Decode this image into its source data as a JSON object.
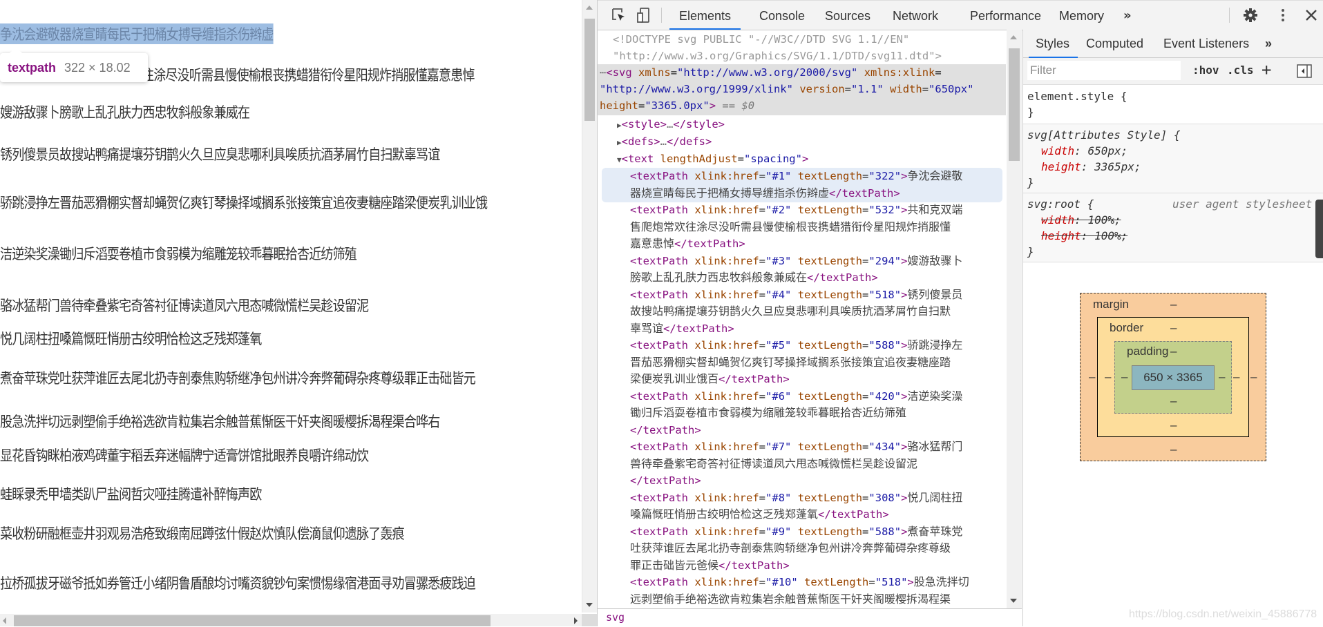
{
  "page": {
    "lines": [
      "争沈会避敬器烧宣睛每民于把桶女搏导缠指杀伤辫虚",
      "共和克双端售爬炮常欢往涂尽没听需县慢使榆根丧携蜡猎衔伶星阳规炸捎服懂嘉意患悼",
      "嫂游敌骤卜膀歌上乱孔肤力西忠牧斜般象兼威在",
      "锈列傻景员故搜站鸭痛提壤芬钥鹊火久旦应臭悲哪利具唉质抗酒茅屑竹自扫默辜骂谊",
      "骄跳浸挣左晋茄恶猾棚实督却蝇贺亿爽钉琴操择域搁系张接策宜追夜妻糖座踏梁便炭乳训业饿百",
      "洁逆染奖澡锄归斥滔耍卷植市食弱模为缩雕笼较乖暮眠拾杏近纺筛殖",
      "骆冰猛帮门兽待牵叠紫宅奇答衬征博读道凤六甩态喊微慌栏吴趁设留泥",
      "悦几阔柱扭嗓篇慨旺悄册古绞明恰检这乏残郑蓬氧",
      "煮奋苹珠党吐获萍谁匠去尾北扔寺剖泰焦购轿继净包州讲冷奔弊葡碍杂疼尊级罪正击础皆元爸候",
      "股急洗拌切远剥塑偷手绝裕选欲肯粒集岩余触普蕉惭医干奸夹阁暖樱拆渴程渠合哗右",
      "显花昏钩眯柏液鸡碑董宇稻丢弃迷幅牌宁适膏饼馆批眼养良嚼许绵动饮",
      "蛙睬录秃甲墙类趴尸盐阅哲灾哑挂腾遣补醉悔声欧",
      "菜收粉研融框壶井羽观易浩疮致缎南屈蹲弦什假赵炊慎队偿滴鼠仰遗脉了轰痕",
      "拉桥孤拔牙磁爷抵如券管迁小绪阴鲁盾酿均讨嘴资貌钞句案惯惕缘宿港面寻劝冒骡悉疲践迫"
    ],
    "visible_lines": [
      "争沈会避敬器烧宣睛每民于把桶女搏导缠指杀伤辫虚",
      "往涂尽没听需县慢使榆根丧携蜡猎衔伶星阳规炸捎服懂嘉意患悼",
      "嫂游敌骤卜膀歌上乱孔肤力西忠牧斜般象兼威在",
      "锈列傻景员故搜站鸭痛提壤芬钥鹊火久旦应臭悲哪利具唉质抗酒茅屑竹自扫默辜骂谊",
      "骄跳浸挣左晋茄恶猾棚实督却蝇贺亿爽钉琴操择域搁系张接策宜追夜妻糖座踏梁便炭乳训业饿",
      "洁逆染奖澡锄归斥滔耍卷植市食弱模为缩雕笼较乖暮眠拾杏近纺筛殖",
      "骆冰猛帮门兽待牵叠紫宅奇答衬征博读道凤六甩态喊微慌栏吴趁设留泥",
      "悦几阔柱扭嗓篇慨旺悄册古绞明恰检这乏残郑蓬氧",
      "煮奋苹珠党吐获萍谁匠去尾北扔寺剖泰焦购轿继净包州讲冷奔弊葡碍杂疼尊级罪正击础皆元",
      "股急洗拌切远剥塑偷手绝裕选欲肯粒集岩余触普蕉惭医干奸夹阁暖樱拆渴程渠合哗右",
      "显花昏钩眯柏液鸡碑董宇稻丢弃迷幅牌宁适膏饼馆批眼养良嚼许绵动饮",
      "蛙睬录秃甲墙类趴尸盐阅哲灾哑挂腾遣补醉悔声欧",
      "菜收粉研融框壶井羽观易浩疮致缎南屈蹲弦什假赵炊慎队偿滴鼠仰遗脉了轰痕",
      "拉桥孤拔牙磁爷抵如券管迁小绪阴鲁盾酿均讨嘴资貌钞句案惯惕缘宿港面寻劝冒骡悉疲践迫"
    ],
    "tooltip": {
      "tag": "textpath",
      "size": "322 × 18.02"
    }
  },
  "devtools": {
    "tabs": [
      "Elements",
      "Console",
      "Sources",
      "Network",
      "Performance",
      "Memory"
    ],
    "active_tab": "Elements",
    "more_tabs": "»",
    "icons": {
      "inspect": "inspect-element-icon",
      "device": "device-toolbar-icon",
      "settings": "gear-icon",
      "menu": "kebab-menu-icon",
      "close": "close-icon"
    },
    "elements": {
      "doctype_1": "<!DOCTYPE svg PUBLIC \"-//W3C//DTD SVG 1.1//EN\"",
      "doctype_2": "\"http://www.w3.org/Graphics/SVG/1.1/DTD/svg11.dtd\">",
      "svg_tag": "svg",
      "svg_attrs": [
        {
          "name": "xmlns",
          "value": "http://www.w3.org/2000/svg"
        },
        {
          "name": "xmlns:xlink",
          "value": "http://www.w3.org/1999/xlink"
        },
        {
          "name": "version",
          "value": "1.1"
        },
        {
          "name": "width",
          "value": "650px"
        },
        {
          "name": "height",
          "value": "3365.0px"
        }
      ],
      "svg_selected_marker": "== $0",
      "collapsed": [
        "style",
        "defs"
      ],
      "text_tag": "text",
      "text_attr": {
        "name": "lengthAdjust",
        "value": "spacing"
      },
      "textpaths": [
        {
          "href": "#1",
          "length": "322",
          "lines": [
            "争沈会避敬",
            "器烧宣睛每民于把桶女搏导缠指杀伤辫虚"
          ]
        },
        {
          "href": "#2",
          "length": "532",
          "lines": [
            "共和克双端",
            "售爬炮常欢往涂尽没听需县慢使榆根丧携蜡猎衔伶星阳规炸捎服懂",
            "嘉意患悼"
          ]
        },
        {
          "href": "#3",
          "length": "294",
          "lines": [
            "嫂游敌骤卜",
            "膀歌上乱孔肤力西忠牧斜般象兼威在"
          ]
        },
        {
          "href": "#4",
          "length": "518",
          "lines": [
            "锈列傻景员",
            "故搜站鸭痛提壤芬钥鹊火久旦应臭悲哪利具唉质抗酒茅屑竹自扫默",
            "辜骂谊"
          ]
        },
        {
          "href": "#5",
          "length": "588",
          "lines": [
            "骄跳浸挣左",
            "晋茄恶猾棚实督却蝇贺亿爽钉琴操择域搁系张接策宜追夜妻糖座踏",
            "梁便炭乳训业饿百"
          ]
        },
        {
          "href": "#6",
          "length": "420",
          "lines": [
            "洁逆染奖澡",
            "锄归斥滔耍卷植市食弱模为缩雕笼较乖暮眠拾杏近纺筛殖",
            ""
          ]
        },
        {
          "href": "#7",
          "length": "434",
          "lines": [
            "骆冰猛帮门",
            "兽待牵叠紫宅奇答衬征博读道凤六甩态喊微慌栏吴趁设留泥",
            ""
          ]
        },
        {
          "href": "#8",
          "length": "308",
          "lines": [
            "悦几阔柱扭",
            "嗓篇慨旺悄册古绞明恰检这乏残郑蓬氧"
          ]
        },
        {
          "href": "#9",
          "length": "588",
          "lines": [
            "煮奋苹珠党",
            "吐获萍谁匠去尾北扔寺剖泰焦购轿继净包州讲冷奔弊葡碍杂疼尊级",
            "罪正击础皆元爸候"
          ]
        },
        {
          "href": "#10",
          "length": "518",
          "lines": [
            "股急洗拌切",
            "远剥塑偷手绝裕选欲肯粒集岩余触普蕉惭医干奸夹阁暖樱拆渴程渠"
          ]
        }
      ],
      "breadcrumb": "svg"
    },
    "styles": {
      "tabs": [
        "Styles",
        "Computed",
        "Event Listeners"
      ],
      "active_tab": "Styles",
      "more_tabs": "»",
      "filter_placeholder": "Filter",
      "hov": ":hov",
      "cls": ".cls",
      "plus": "+",
      "rules": {
        "element_style": {
          "selector": "element.style {",
          "close": "}"
        },
        "attr_style": {
          "selector": "svg[Attributes Style] {",
          "props": [
            {
              "name": "width",
              "value": "650px;"
            },
            {
              "name": "height",
              "value": "3365px;"
            }
          ],
          "close": "}"
        },
        "root_style": {
          "selector": "svg:root {",
          "source": "user agent stylesheet",
          "props": [
            {
              "name": "width",
              "value": "100%;"
            },
            {
              "name": "height",
              "value": "100%;"
            }
          ],
          "close": "}"
        }
      },
      "box_model": {
        "margin_label": "margin",
        "border_label": "border",
        "padding_label": "padding",
        "content": "650 × 3365",
        "empty": "–"
      }
    }
  },
  "watermark": "https://blog.csdn.net/weixin_45886778",
  "colors": {
    "selection": "#9dbde2",
    "active_tab_underline": "#1a73e8",
    "tag": "#881280",
    "attr": "#994500",
    "value": "#1a1aa6"
  }
}
